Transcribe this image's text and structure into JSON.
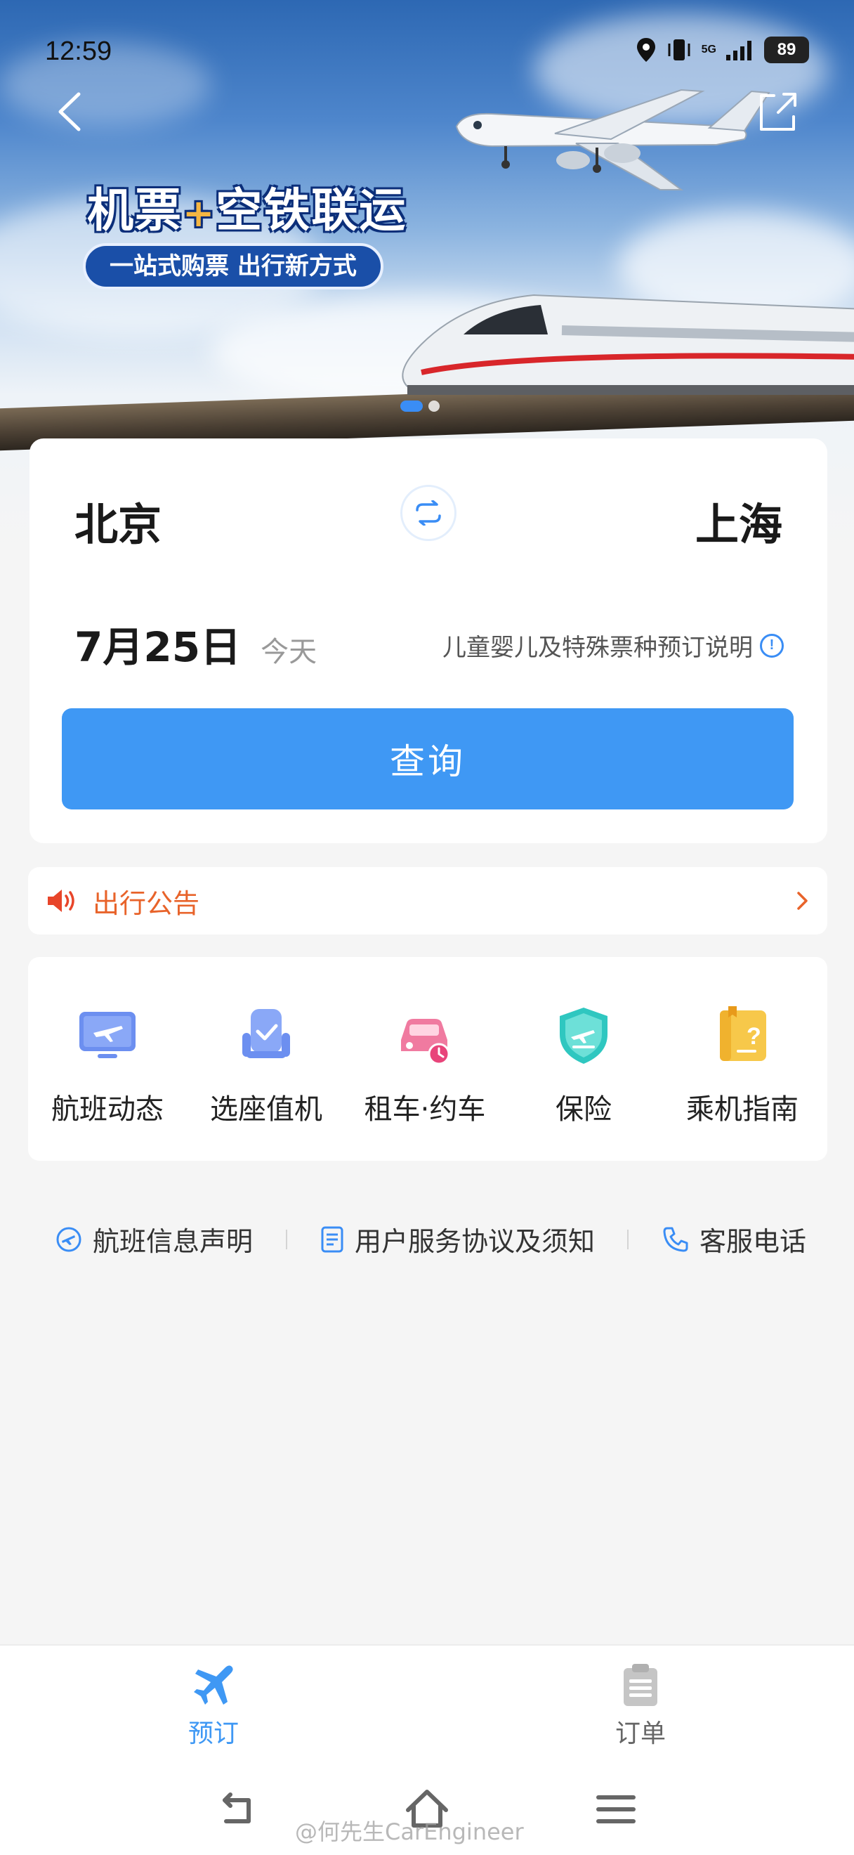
{
  "status_bar": {
    "time": "12:59",
    "network": "5G",
    "battery": "89"
  },
  "banner": {
    "title_part1": "机票",
    "title_plus": "+",
    "title_part2": "空铁联运",
    "subtitle": "一站式购票 出行新方式",
    "slide_count": 2,
    "active_slide": 1
  },
  "search": {
    "from_city": "北京",
    "to_city": "上海",
    "date": "7月25日",
    "date_hint": "今天",
    "notice_link": "儿童婴儿及特殊票种预订说明",
    "search_button": "查询"
  },
  "announcement": {
    "label": "出行公告"
  },
  "services": [
    {
      "label": "航班动态",
      "icon": "flight-status-icon"
    },
    {
      "label": "选座值机",
      "icon": "seat-checkin-icon"
    },
    {
      "label": "租车·约车",
      "icon": "car-rental-icon"
    },
    {
      "label": "保险",
      "icon": "insurance-icon"
    },
    {
      "label": "乘机指南",
      "icon": "boarding-guide-icon"
    }
  ],
  "footer_links": [
    {
      "label": "航班信息声明",
      "icon": "statement-icon"
    },
    {
      "label": "用户服务协议及须知",
      "icon": "document-icon"
    },
    {
      "label": "客服电话",
      "icon": "phone-icon"
    }
  ],
  "tabbar": {
    "tabs": [
      {
        "label": "预订",
        "icon": "airplane-icon",
        "active": true
      },
      {
        "label": "订单",
        "icon": "clipboard-icon",
        "active": false
      }
    ]
  },
  "colors": {
    "accent": "#3f98f4",
    "announcement": "#e8632a",
    "banner_dark": "#2d68b3"
  },
  "watermark": "@何先生CarEngineer"
}
